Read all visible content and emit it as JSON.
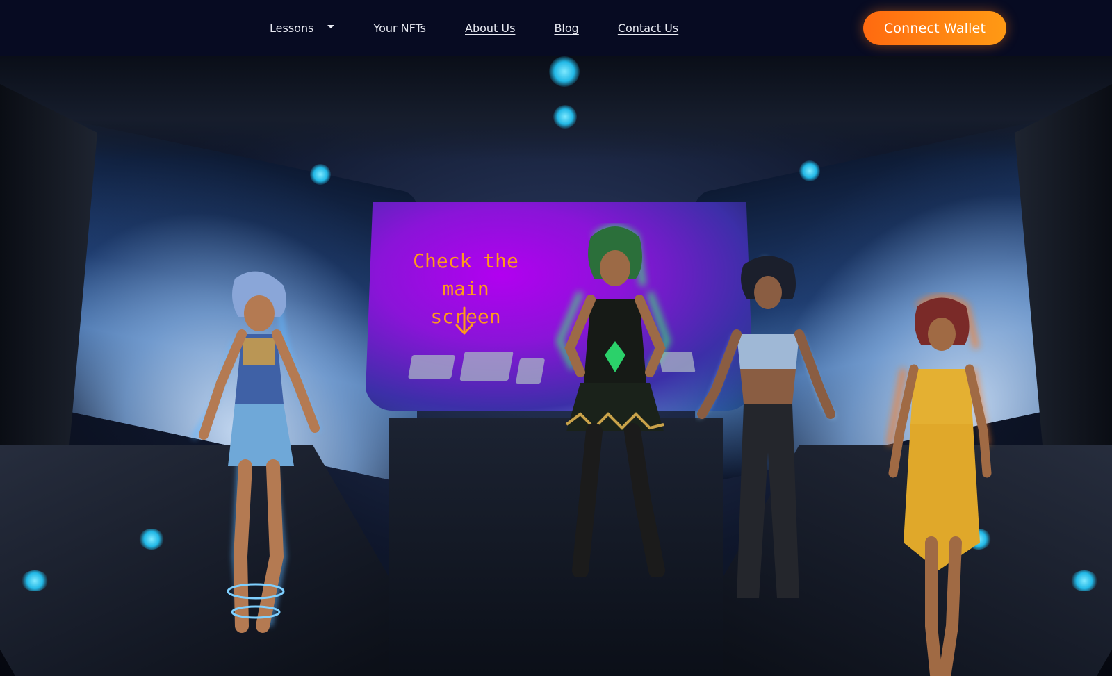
{
  "nav": {
    "items": [
      {
        "label": "Lessons",
        "has_dropdown": true,
        "underlined": false
      },
      {
        "label": "Your NFTs",
        "has_dropdown": false,
        "underlined": false
      },
      {
        "label": "About Us",
        "has_dropdown": false,
        "underlined": true
      },
      {
        "label": "Blog",
        "has_dropdown": false,
        "underlined": true
      },
      {
        "label": "Contact Us",
        "has_dropdown": false,
        "underlined": true
      }
    ],
    "cta_label": "Connect Wallet"
  },
  "hero": {
    "callout_line1": "Check the main",
    "callout_line2": "screen",
    "arrow_icon": "arrow-down-icon",
    "characters": [
      {
        "id": "blue-character",
        "glow": "#5fb6ff"
      },
      {
        "id": "green-character",
        "glow": "#34ff6a"
      },
      {
        "id": "electric-character",
        "glow": "#9fd6ff"
      },
      {
        "id": "fire-character",
        "glow": "#ff7a1a"
      }
    ]
  },
  "colors": {
    "nav_bg": "#070b22",
    "cta_gradient_start": "#ff6a10",
    "cta_gradient_end": "#ff9a14",
    "callout_text": "#ff9a1a",
    "main_screen_glow": "#b200f0"
  }
}
